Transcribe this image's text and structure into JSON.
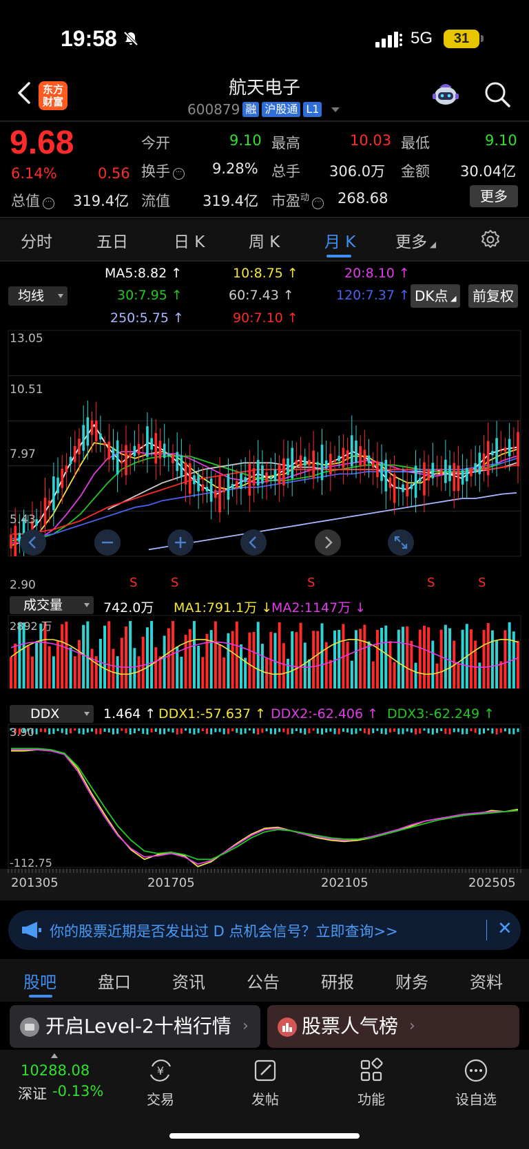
{
  "status_bar": {
    "time": "19:58",
    "network": "5G",
    "battery": "31"
  },
  "header": {
    "logo_text": "东方财富",
    "stock_name": "航天电子",
    "stock_code": "600879",
    "tags": [
      "融",
      "沪股通",
      "L1"
    ]
  },
  "quote": {
    "price": "9.68",
    "change_pct": "6.14%",
    "change": "0.56",
    "open_label": "今开",
    "open": "9.10",
    "high_label": "最高",
    "high": "10.03",
    "low_label": "最低",
    "low": "9.10",
    "turnover_label": "换手",
    "turnover": "9.28%",
    "volume_label": "总手",
    "volume": "306.0万",
    "amount_label": "金额",
    "amount": "30.04亿",
    "mcap_label": "总值",
    "mcap": "319.4亿",
    "float_label": "流值",
    "float": "319.4亿",
    "pe_label": "市盈",
    "pe_sup": "动",
    "pe": "268.68",
    "more_label": "更多"
  },
  "period_tabs": [
    "分时",
    "五日",
    "日 K",
    "周 K",
    "月 K",
    "更多"
  ],
  "active_period": "月 K",
  "indicator": {
    "selector": "均线",
    "ma": [
      {
        "label": "MA5:8.82 ↑",
        "color": "#ffffff"
      },
      {
        "label": "10:8.75 ↑",
        "color": "#f5e63c"
      },
      {
        "label": "20:8.10 ↑",
        "color": "#e23ce8"
      },
      {
        "label": "30:7.95 ↑",
        "color": "#22c822"
      },
      {
        "label": "60:7.43 ↑",
        "color": "#cfcfcf"
      },
      {
        "label": "120:7.37 ↑",
        "color": "#4a62f0"
      },
      {
        "label": "250:5.75 ↑",
        "color": "#a9b7ff"
      },
      {
        "label": "90:7.10 ↑",
        "color": "#ff2b2b"
      }
    ],
    "dk_label": "DK点",
    "adjust_label": "前复权"
  },
  "chart_data": [
    {
      "type": "candlestick",
      "y_ticks": [
        "13.05",
        "10.51",
        "7.97",
        "5.43",
        "2.90"
      ],
      "ylim": [
        2.9,
        13.05
      ],
      "markers": [
        "S",
        "S",
        "S",
        "S",
        "S"
      ],
      "series": [
        {
          "name": "MA5",
          "color": "#ffffff",
          "values": [
            3.6,
            3.8,
            4.5,
            5.5,
            6.8,
            7.9,
            8.8,
            7.8,
            7.1,
            7.6,
            8.0,
            7.7,
            7.2,
            6.5,
            6.0,
            5.7,
            6.0,
            6.3,
            6.6,
            6.4,
            6.8,
            7.2,
            7.1,
            7.0,
            7.3,
            7.6,
            7.3,
            6.7,
            6.0,
            5.9,
            6.4,
            6.8,
            6.6,
            6.4,
            6.9,
            7.5,
            7.7,
            7.8
          ]
        },
        {
          "name": "MA10",
          "color": "#f5e63c",
          "values": [
            3.4,
            3.6,
            4.0,
            4.8,
            5.9,
            7.0,
            8.0,
            7.9,
            7.5,
            7.3,
            7.5,
            7.6,
            7.4,
            6.9,
            6.4,
            6.0,
            5.9,
            6.1,
            6.4,
            6.5,
            6.6,
            7.0,
            7.1,
            7.0,
            7.1,
            7.4,
            7.4,
            7.0,
            6.5,
            6.2,
            6.2,
            6.6,
            6.7,
            6.6,
            6.7,
            7.2,
            7.5,
            7.7
          ]
        },
        {
          "name": "MA20",
          "color": "#e23ce8",
          "values": [
            3.5,
            3.5,
            3.7,
            4.1,
            4.8,
            5.6,
            6.6,
            7.3,
            7.6,
            7.6,
            7.5,
            7.5,
            7.5,
            7.3,
            7.0,
            6.7,
            6.4,
            6.3,
            6.2,
            6.3,
            6.4,
            6.6,
            6.8,
            6.9,
            7.0,
            7.1,
            7.2,
            7.1,
            6.9,
            6.7,
            6.6,
            6.5,
            6.6,
            6.7,
            6.7,
            6.9,
            7.2,
            7.4
          ]
        },
        {
          "name": "MA30",
          "color": "#22c822",
          "values": [
            3.6,
            3.6,
            3.7,
            3.9,
            4.3,
            4.8,
            5.5,
            6.2,
            6.8,
            7.1,
            7.3,
            7.4,
            7.4,
            7.4,
            7.2,
            7.0,
            6.8,
            6.6,
            6.4,
            6.3,
            6.3,
            6.4,
            6.5,
            6.7,
            6.8,
            6.9,
            7.0,
            7.0,
            7.0,
            6.9,
            6.8,
            6.7,
            6.7,
            6.7,
            6.8,
            6.9,
            7.1,
            7.3
          ]
        },
        {
          "name": "MA60",
          "color": "#cfcfcf",
          "values": [
            null,
            null,
            null,
            null,
            null,
            null,
            null,
            5.0,
            5.3,
            5.6,
            5.9,
            6.2,
            6.4,
            6.6,
            6.8,
            6.9,
            7.0,
            7.1,
            7.1,
            7.1,
            7.0,
            6.9,
            6.9,
            6.8,
            6.8,
            6.8,
            6.8,
            6.8,
            6.7,
            6.7,
            6.7,
            6.6,
            6.6,
            6.6,
            6.7,
            6.8,
            6.9,
            7.1
          ]
        },
        {
          "name": "MA90",
          "color": "#ff2b2b",
          "values": [
            3.9,
            3.9,
            4.0,
            4.1,
            4.3,
            4.5,
            4.8,
            5.1,
            5.3,
            5.5,
            5.7,
            5.9,
            6.1,
            6.3,
            6.4,
            6.5,
            6.6,
            6.7,
            6.8,
            6.8,
            6.8,
            6.8,
            6.8,
            6.8,
            6.8,
            6.8,
            6.8,
            6.8,
            6.8,
            6.8,
            6.8,
            6.8,
            6.8,
            6.8,
            6.8,
            6.8,
            6.9,
            7.0
          ]
        },
        {
          "name": "MA120",
          "color": "#4a62f0",
          "values": [
            3.7,
            3.7,
            3.8,
            3.9,
            4.1,
            4.3,
            4.5,
            4.7,
            4.9,
            5.1,
            5.2,
            5.4,
            5.5,
            5.6,
            5.7,
            5.8,
            5.9,
            6.0,
            6.0,
            6.1,
            6.2,
            6.3,
            6.4,
            6.5,
            6.6,
            6.6,
            6.7,
            6.7,
            6.7,
            6.7,
            6.8,
            6.8,
            6.8,
            6.8,
            6.9,
            7.0,
            7.1,
            7.3
          ]
        },
        {
          "name": "MA250",
          "color": "#a9b7ff",
          "values": [
            null,
            null,
            null,
            null,
            null,
            null,
            null,
            null,
            null,
            null,
            3.2,
            3.3,
            3.4,
            3.5,
            3.6,
            3.7,
            3.8,
            3.9,
            4.0,
            4.1,
            4.2,
            4.3,
            4.4,
            4.5,
            4.6,
            4.7,
            4.8,
            4.9,
            5.0,
            5.1,
            5.2,
            5.3,
            5.4,
            5.5,
            5.5,
            5.6,
            5.7,
            5.75
          ]
        }
      ]
    },
    {
      "type": "bar",
      "selector": "成交量",
      "last_value": "742.0万",
      "ma1_label": "MA1:791.1万 ↓",
      "ma2_label": "MA2:1147万 ↓",
      "y_ticks": [
        "2892 万"
      ],
      "ylim": [
        0,
        2892
      ]
    },
    {
      "type": "line",
      "selector": "DDX",
      "value_label": "1.464 ↑",
      "ddx1_label": "DDX1:-57.637 ↑",
      "ddx2_label": "DDX2:-62.406 ↑",
      "ddx3_label": "DDX3:-62.249 ↑",
      "y_ticks": [
        "3.90",
        "-112.75"
      ],
      "ylim": [
        -112.75,
        3.9
      ],
      "x_ticks": [
        "201305",
        "201705",
        "202105",
        "202505"
      ],
      "series": [
        {
          "name": "DDX1",
          "color": "#f5e63c",
          "values": [
            -15,
            -15,
            -14,
            -15,
            -17,
            -30,
            -50,
            -68,
            -85,
            -98,
            -106,
            -102,
            -100,
            -103,
            -112,
            -108,
            -100,
            -92,
            -85,
            -80,
            -79,
            -82,
            -85,
            -88,
            -90,
            -91,
            -90,
            -88,
            -85,
            -82,
            -78,
            -74,
            -72,
            -70,
            -68,
            -68,
            -65,
            -66,
            -64
          ]
        },
        {
          "name": "DDX2",
          "color": "#e23ce8",
          "values": [
            -14,
            -14,
            -14,
            -15,
            -18,
            -32,
            -52,
            -70,
            -86,
            -97,
            -104,
            -103,
            -101,
            -104,
            -110,
            -107,
            -100,
            -93,
            -86,
            -81,
            -80,
            -82,
            -85,
            -87,
            -89,
            -90,
            -89,
            -87,
            -84,
            -81,
            -77,
            -74,
            -72,
            -70,
            -68,
            -67,
            -66,
            -66,
            -65
          ]
        },
        {
          "name": "DDX3",
          "color": "#22c822",
          "values": [
            -13,
            -13,
            -13,
            -14,
            -17,
            -28,
            -45,
            -62,
            -78,
            -90,
            -99,
            -101,
            -100,
            -102,
            -106,
            -106,
            -101,
            -95,
            -88,
            -83,
            -81,
            -82,
            -84,
            -86,
            -88,
            -89,
            -89,
            -88,
            -85,
            -82,
            -79,
            -76,
            -73,
            -71,
            -69,
            -68,
            -67,
            -66,
            -65
          ]
        }
      ]
    }
  ],
  "banner": {
    "text": "你的股票近期是否发出过 D 点机会信号？立即查询>>"
  },
  "sub_tabs": [
    "股吧",
    "盘口",
    "资讯",
    "公告",
    "研报",
    "财务",
    "资料"
  ],
  "cards": [
    {
      "label": "开启Level-2十档行情"
    },
    {
      "label": "股票人气榜"
    }
  ],
  "tab_bar": {
    "index_value": "10288.08",
    "index_name": "深证",
    "index_change": "-0.13%",
    "items": [
      {
        "label": "交易"
      },
      {
        "label": "发帖"
      },
      {
        "label": "功能"
      },
      {
        "label": "设自选"
      }
    ]
  }
}
